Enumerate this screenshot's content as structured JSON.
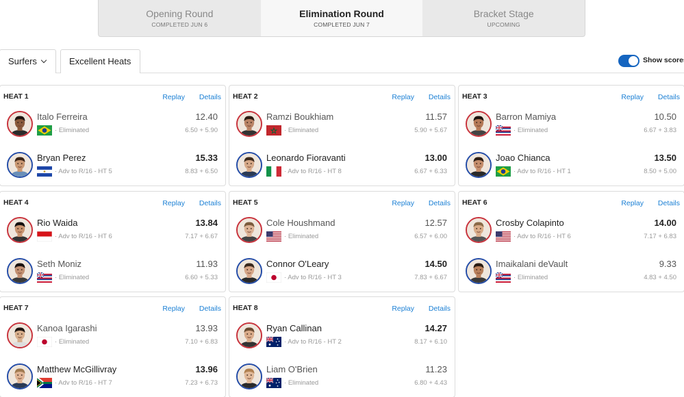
{
  "rounds": [
    {
      "name": "Opening Round",
      "status": "COMPLETED JUN 6",
      "active": false
    },
    {
      "name": "Elimination Round",
      "status": "COMPLETED JUN 7",
      "active": true
    },
    {
      "name": "Bracket Stage",
      "status": "UPCOMING",
      "active": false
    }
  ],
  "filters": {
    "surfers_label": "Surfers",
    "excellent_label": "Excellent Heats",
    "show_scores_label": "Show scores",
    "show_scores_on": true
  },
  "links": {
    "replay": "Replay",
    "details": "Details"
  },
  "heats": [
    {
      "title": "HEAT 1",
      "surfers": [
        {
          "name": "Italo Ferreira",
          "country": "BR",
          "status": "Eliminated",
          "score": "12.40",
          "waves": "6.50 + 5.90",
          "advanced": false,
          "skin": "#8a5a3c",
          "hair": "#1e1410",
          "shirt": "#2b2b2b"
        },
        {
          "name": "Bryan Perez",
          "country": "SV",
          "status": "Adv to R/16 - HT 5",
          "score": "15.33",
          "waves": "8.83 + 6.50",
          "advanced": true,
          "skin": "#c99873",
          "hair": "#3a2416",
          "shirt": "#6a8fb8"
        }
      ]
    },
    {
      "title": "HEAT 2",
      "surfers": [
        {
          "name": "Ramzi Boukhiam",
          "country": "MA",
          "status": "Eliminated",
          "score": "11.57",
          "waves": "5.90 + 5.67",
          "advanced": false,
          "skin": "#b98466",
          "hair": "#2a1a12",
          "shirt": "#333"
        },
        {
          "name": "Leonardo Fioravanti",
          "country": "IT",
          "status": "Adv to R/16 - HT 8",
          "score": "13.00",
          "waves": "6.67 + 6.33",
          "advanced": true,
          "skin": "#d6a988",
          "hair": "#3d2a1c",
          "shirt": "#2a3a55"
        }
      ]
    },
    {
      "title": "HEAT 3",
      "surfers": [
        {
          "name": "Barron Mamiya",
          "country": "HI",
          "status": "Eliminated",
          "score": "10.50",
          "waves": "6.67 + 3.83",
          "advanced": false,
          "skin": "#b57a58",
          "hair": "#1a120e",
          "shirt": "#444"
        },
        {
          "name": "Joao Chianca",
          "country": "BR",
          "status": "Adv to R/16 - HT 1",
          "score": "13.50",
          "waves": "8.50 + 5.00",
          "advanced": true,
          "skin": "#c58e6c",
          "hair": "#2c1c12",
          "shirt": "#2a2a2a"
        }
      ]
    },
    {
      "title": "HEAT 4",
      "surfers": [
        {
          "name": "Rio Waida",
          "country": "ID",
          "status": "Adv to R/16 - HT 6",
          "score": "13.84",
          "waves": "7.17 + 6.67",
          "advanced": true,
          "skin": "#c99470",
          "hair": "#141010",
          "shirt": "#333"
        },
        {
          "name": "Seth Moniz",
          "country": "HI",
          "status": "Eliminated",
          "score": "11.93",
          "waves": "6.60 + 5.33",
          "advanced": false,
          "skin": "#c29072",
          "hair": "#1a120e",
          "shirt": "#3a3a3a"
        }
      ]
    },
    {
      "title": "HEAT 5",
      "surfers": [
        {
          "name": "Cole Houshmand",
          "country": "US",
          "status": "Eliminated",
          "score": "12.57",
          "waves": "6.57 + 6.00",
          "advanced": false,
          "skin": "#dcb295",
          "hair": "#7a5a3c",
          "shirt": "#444"
        },
        {
          "name": "Connor O'Leary",
          "country": "JP",
          "status": "Adv to R/16 - HT 3",
          "score": "14.50",
          "waves": "7.83 + 6.67",
          "advanced": true,
          "skin": "#d6a688",
          "hair": "#3a2a1e",
          "shirt": "#2a2a2a"
        }
      ]
    },
    {
      "title": "HEAT 6",
      "surfers": [
        {
          "name": "Crosby Colapinto",
          "country": "US",
          "status": "Adv to R/16 - HT 6",
          "score": "14.00",
          "waves": "7.17 + 6.83",
          "advanced": true,
          "skin": "#d9ab88",
          "hair": "#8a6a48",
          "shirt": "#555"
        },
        {
          "name": "Imaikalani deVault",
          "country": "HI",
          "status": "Eliminated",
          "score": "9.33",
          "waves": "4.83 + 4.50",
          "advanced": false,
          "skin": "#b8805c",
          "hair": "#2a1c12",
          "shirt": "#3a3a3a"
        }
      ]
    },
    {
      "title": "HEAT 7",
      "surfers": [
        {
          "name": "Kanoa Igarashi",
          "country": "JP",
          "status": "Eliminated",
          "score": "13.93",
          "waves": "7.10 + 6.83",
          "advanced": false,
          "skin": "#d7ae8c",
          "hair": "#1c1410",
          "shirt": "#ddd"
        },
        {
          "name": "Matthew McGillivray",
          "country": "ZA",
          "status": "Adv to R/16 - HT 7",
          "score": "13.96",
          "waves": "7.23 + 6.73",
          "advanced": true,
          "skin": "#deb394",
          "hair": "#a07a50",
          "shirt": "#2a3a55"
        }
      ]
    },
    {
      "title": "HEAT 8",
      "surfers": [
        {
          "name": "Ryan Callinan",
          "country": "AU",
          "status": "Adv to R/16 - HT 2",
          "score": "14.27",
          "waves": "8.17 + 6.10",
          "advanced": true,
          "skin": "#d9ab8a",
          "hair": "#6a4a30",
          "shirt": "#333"
        },
        {
          "name": "Liam O'Brien",
          "country": "AU",
          "status": "Eliminated",
          "score": "11.23",
          "waves": "6.80 + 4.43",
          "advanced": false,
          "skin": "#e0b898",
          "hair": "#b08050",
          "shirt": "#2a2a2a"
        }
      ]
    }
  ]
}
